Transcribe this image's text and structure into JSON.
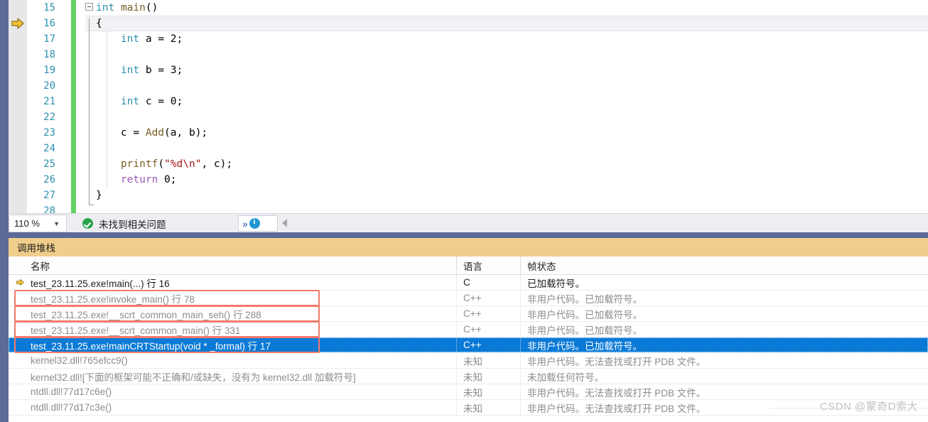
{
  "editor": {
    "exec_arrow_icon": "yellow-right-arrow-icon",
    "lines": [
      {
        "num": "15",
        "text": "int main()"
      },
      {
        "num": "16",
        "text": "{"
      },
      {
        "num": "17",
        "text": "    int a = 2;"
      },
      {
        "num": "18",
        "text": ""
      },
      {
        "num": "19",
        "text": "    int b = 3;"
      },
      {
        "num": "20",
        "text": ""
      },
      {
        "num": "21",
        "text": "    int c = 0;"
      },
      {
        "num": "22",
        "text": ""
      },
      {
        "num": "23",
        "text": "    c = Add(a, b);"
      },
      {
        "num": "24",
        "text": ""
      },
      {
        "num": "25",
        "text": "    printf(\"%d\\n\", c);"
      },
      {
        "num": "26",
        "text": "    return 0;"
      },
      {
        "num": "27",
        "text": "}"
      },
      {
        "num": "28",
        "text": ""
      }
    ],
    "current_line": "16"
  },
  "statusbar": {
    "zoom_level": "110 %",
    "zoom_caret_icon": "chevron-down-icon",
    "status_icon": "green-check-icon",
    "status_text": "未找到相关问题",
    "next_icon": "double-chevron-right-icon",
    "info_icon": "info-circle-icon",
    "collapse_icon": "left-triangle-icon"
  },
  "callstack": {
    "panel_title": "调用堆栈",
    "columns": [
      "名称",
      "语言",
      "帧状态"
    ],
    "rows": [
      {
        "arrow": true,
        "name": "test_23.11.25.exe!main(...) 行 16",
        "lang": "C",
        "frame": "已加载符号。",
        "state": "current",
        "annotated": false
      },
      {
        "arrow": false,
        "name": "test_23.11.25.exe!invoke_main() 行 78",
        "lang": "C++",
        "frame": "非用户代码。已加载符号。",
        "state": "dim",
        "annotated": true
      },
      {
        "arrow": false,
        "name": "test_23.11.25.exe!__scrt_common_main_seh() 行 288",
        "lang": "C++",
        "frame": "非用户代码。已加载符号。",
        "state": "dim",
        "annotated": true
      },
      {
        "arrow": false,
        "name": "test_23.11.25.exe!__scrt_common_main() 行 331",
        "lang": "C++",
        "frame": "非用户代码。已加载符号。",
        "state": "dim",
        "annotated": true
      },
      {
        "arrow": false,
        "name": "test_23.11.25.exe!mainCRTStartup(void * _formal) 行 17",
        "lang": "C++",
        "frame": "非用户代码。已加载符号。",
        "state": "selected",
        "annotated": true
      },
      {
        "arrow": false,
        "name": "kernel32.dll!765efcc9()",
        "lang": "未知",
        "frame": "非用户代码。无法查找或打开 PDB 文件。",
        "state": "dim",
        "annotated": false
      },
      {
        "arrow": false,
        "name": "kernel32.dll![下面的框架可能不正确和/或缺失，没有为 kernel32.dll 加载符号]",
        "lang": "未知",
        "frame": "未加载任何符号。",
        "state": "dim",
        "annotated": false
      },
      {
        "arrow": false,
        "name": "ntdll.dll!77d17c6e()",
        "lang": "未知",
        "frame": "非用户代码。无法查找或打开 PDB 文件。",
        "state": "dim",
        "annotated": false
      },
      {
        "arrow": false,
        "name": "ntdll.dll!77d17c3e()",
        "lang": "未知",
        "frame": "非用户代码。无法查找或打开 PDB 文件。",
        "state": "dim",
        "annotated": false
      }
    ]
  },
  "watermark": {
    "text": "CSDN @蒙奇D索大"
  },
  "colors": {
    "accent_blue": "#5b6a96",
    "panel_header": "#f0cd8b",
    "selection_blue": "#0a7ad6",
    "annotation_red": "#f4796b",
    "changebar_green": "#64d264"
  }
}
